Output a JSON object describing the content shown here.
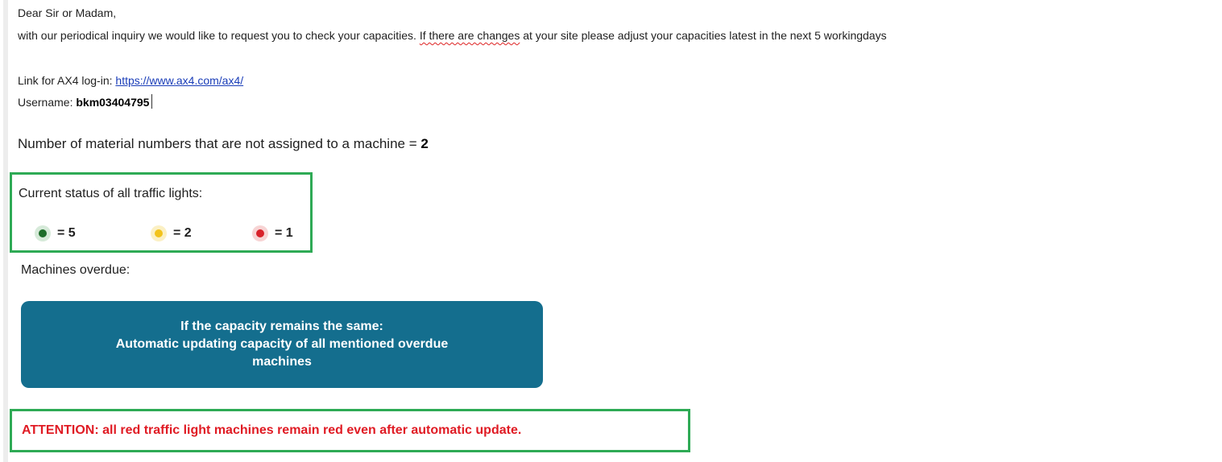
{
  "email": {
    "greeting": "Dear Sir or Madam,",
    "inquiry": {
      "part1": "with our periodical inquiry we would like to request you to check your capacities. ",
      "flagged": "If there are changes",
      "part2": " at your site please adjust your capacities latest in the next 5 workingdays"
    },
    "login": {
      "label": "Link for AX4 log-in: ",
      "url": "https://www.ax4.com/ax4/"
    },
    "username": {
      "label": "Username: ",
      "value": "bkm03404795"
    },
    "unassigned": {
      "label": "Number of material numbers that are not assigned to a machine = ",
      "value": "2"
    },
    "traffic_lights": {
      "title": "Current status of all traffic lights:",
      "green": {
        "count": "= 5",
        "color": "#1e6d2a"
      },
      "yellow": {
        "count": "= 2",
        "color": "#f2c31c"
      },
      "red": {
        "count": "= 1",
        "color": "#d8222b"
      }
    },
    "overdue": {
      "title": "Machines overdue:"
    },
    "capacity_button": {
      "line1": "If the capacity remains the same:",
      "line2": "Automatic updating capacity of all mentioned overdue",
      "line3": "machines",
      "color": "#146e8e"
    },
    "attention": {
      "text": "ATTENTION: all red traffic light machines remain red even after automatic update.",
      "color": "#e01b24"
    },
    "highlight_border_color": "#2eaa55"
  }
}
